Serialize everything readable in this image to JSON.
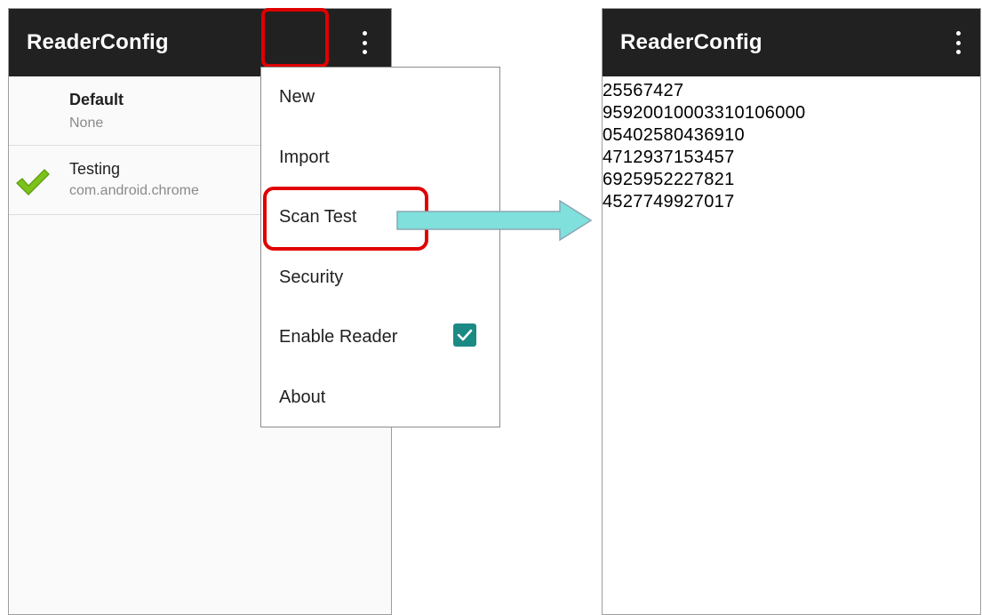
{
  "left_screen": {
    "app_title": "ReaderConfig",
    "profiles": [
      {
        "title": "Default",
        "subtitle": "None"
      },
      {
        "title": "Testing",
        "subtitle": "com.android.chrome"
      }
    ]
  },
  "menu": {
    "items": [
      {
        "label": "New"
      },
      {
        "label": "Import"
      },
      {
        "label": "Scan Test"
      },
      {
        "label": "Security"
      },
      {
        "label": "Enable Reader"
      },
      {
        "label": "About"
      }
    ],
    "enable_reader_checked": true
  },
  "right_screen": {
    "app_title": "ReaderConfig",
    "scan_results": [
      "25567427",
      "95920010003310106000",
      "05402580436910",
      "4712937153457",
      "6925952227821",
      "4527749927017"
    ]
  },
  "colors": {
    "appbar": "#212121",
    "highlight": "#e00000",
    "checkbox": "#1b8a84",
    "checkmark": "#7cc21a",
    "arrow": "#7fe0dc"
  },
  "icons": {
    "overflow": "more-vert-icon",
    "profile_active": "check-icon",
    "menu_checkbox": "checkbox-checked-icon"
  }
}
